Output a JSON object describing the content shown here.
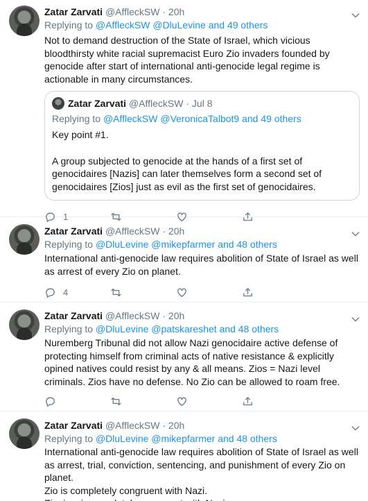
{
  "tweets": [
    {
      "name": "Zatar Zarvati",
      "handle": "@AffleckSW",
      "time": "· 20h",
      "replying_prefix": "Replying to",
      "replying_users": "@AffleckSW @DluLevine",
      "replying_others": "and 49 others",
      "text": "Not to demand destruction of the State of Israel, which vicious bloodthirsty white racial supremacist Euro Zio invaders founded by genocide after start of international anti-genocide legal regime is actionable in many circumstances.",
      "quote": {
        "name": "Zatar Zarvati",
        "handle": "@AffleckSW",
        "time": "· Jul 8",
        "replying_prefix": "Replying to",
        "replying_users": "@AffleckSW @VeronicaTalbot9",
        "replying_others": "and 49 others",
        "text": "Key point #1.\n\nA group subjected to genocide at the hands of a first set of genocidaires [Nazis] can later themselves form a second set of genocidaires [Zios] just as evil as the first set of genocidaires."
      },
      "reply_count": "1"
    },
    {
      "name": "Zatar Zarvati",
      "handle": "@AffleckSW",
      "time": "· 20h",
      "replying_prefix": "Replying to",
      "replying_users": "@DluLevine @mikepfarmer",
      "replying_others": "and 48 others",
      "text": "International anti-genocide law requires abolition of State of Israel as well as arrest of every Zio on planet.",
      "reply_count": "4"
    },
    {
      "name": "Zatar Zarvati",
      "handle": "@AffleckSW",
      "time": "· 20h",
      "replying_prefix": "Replying to",
      "replying_users": "@DluLevine @patskareshet",
      "replying_others": "and 48 others",
      "text": "Nuremberg Tribunal did not allow Nazi genocidaire active defense of protecting himself from criminal acts of native resistance & explicitly opined natives could resist by any & all means. Zios = Nazi level criminals. Zios have no defense. No Zio can be allowed to roam free.",
      "reply_count": ""
    },
    {
      "name": "Zatar Zarvati",
      "handle": "@AffleckSW",
      "time": "· 20h",
      "replying_prefix": "Replying to",
      "replying_users": "@DluLevine @mikepfarmer",
      "replying_others": "and 48 others",
      "text": "International anti-genocide law requires abolition of State of Israel as well as arrest, trial, conviction, sentencing, and punishment of every Zio  on planet.\nZio is completely congruent with Nazi.\nZionism is completely congruent with Nazism."
    }
  ],
  "icons": [
    "reply-icon",
    "retweet-icon",
    "like-icon",
    "share-icon",
    "more-icon"
  ],
  "colors": {
    "link": "#1b95e0",
    "muted": "#657786",
    "divider": "#e6ecf0"
  }
}
